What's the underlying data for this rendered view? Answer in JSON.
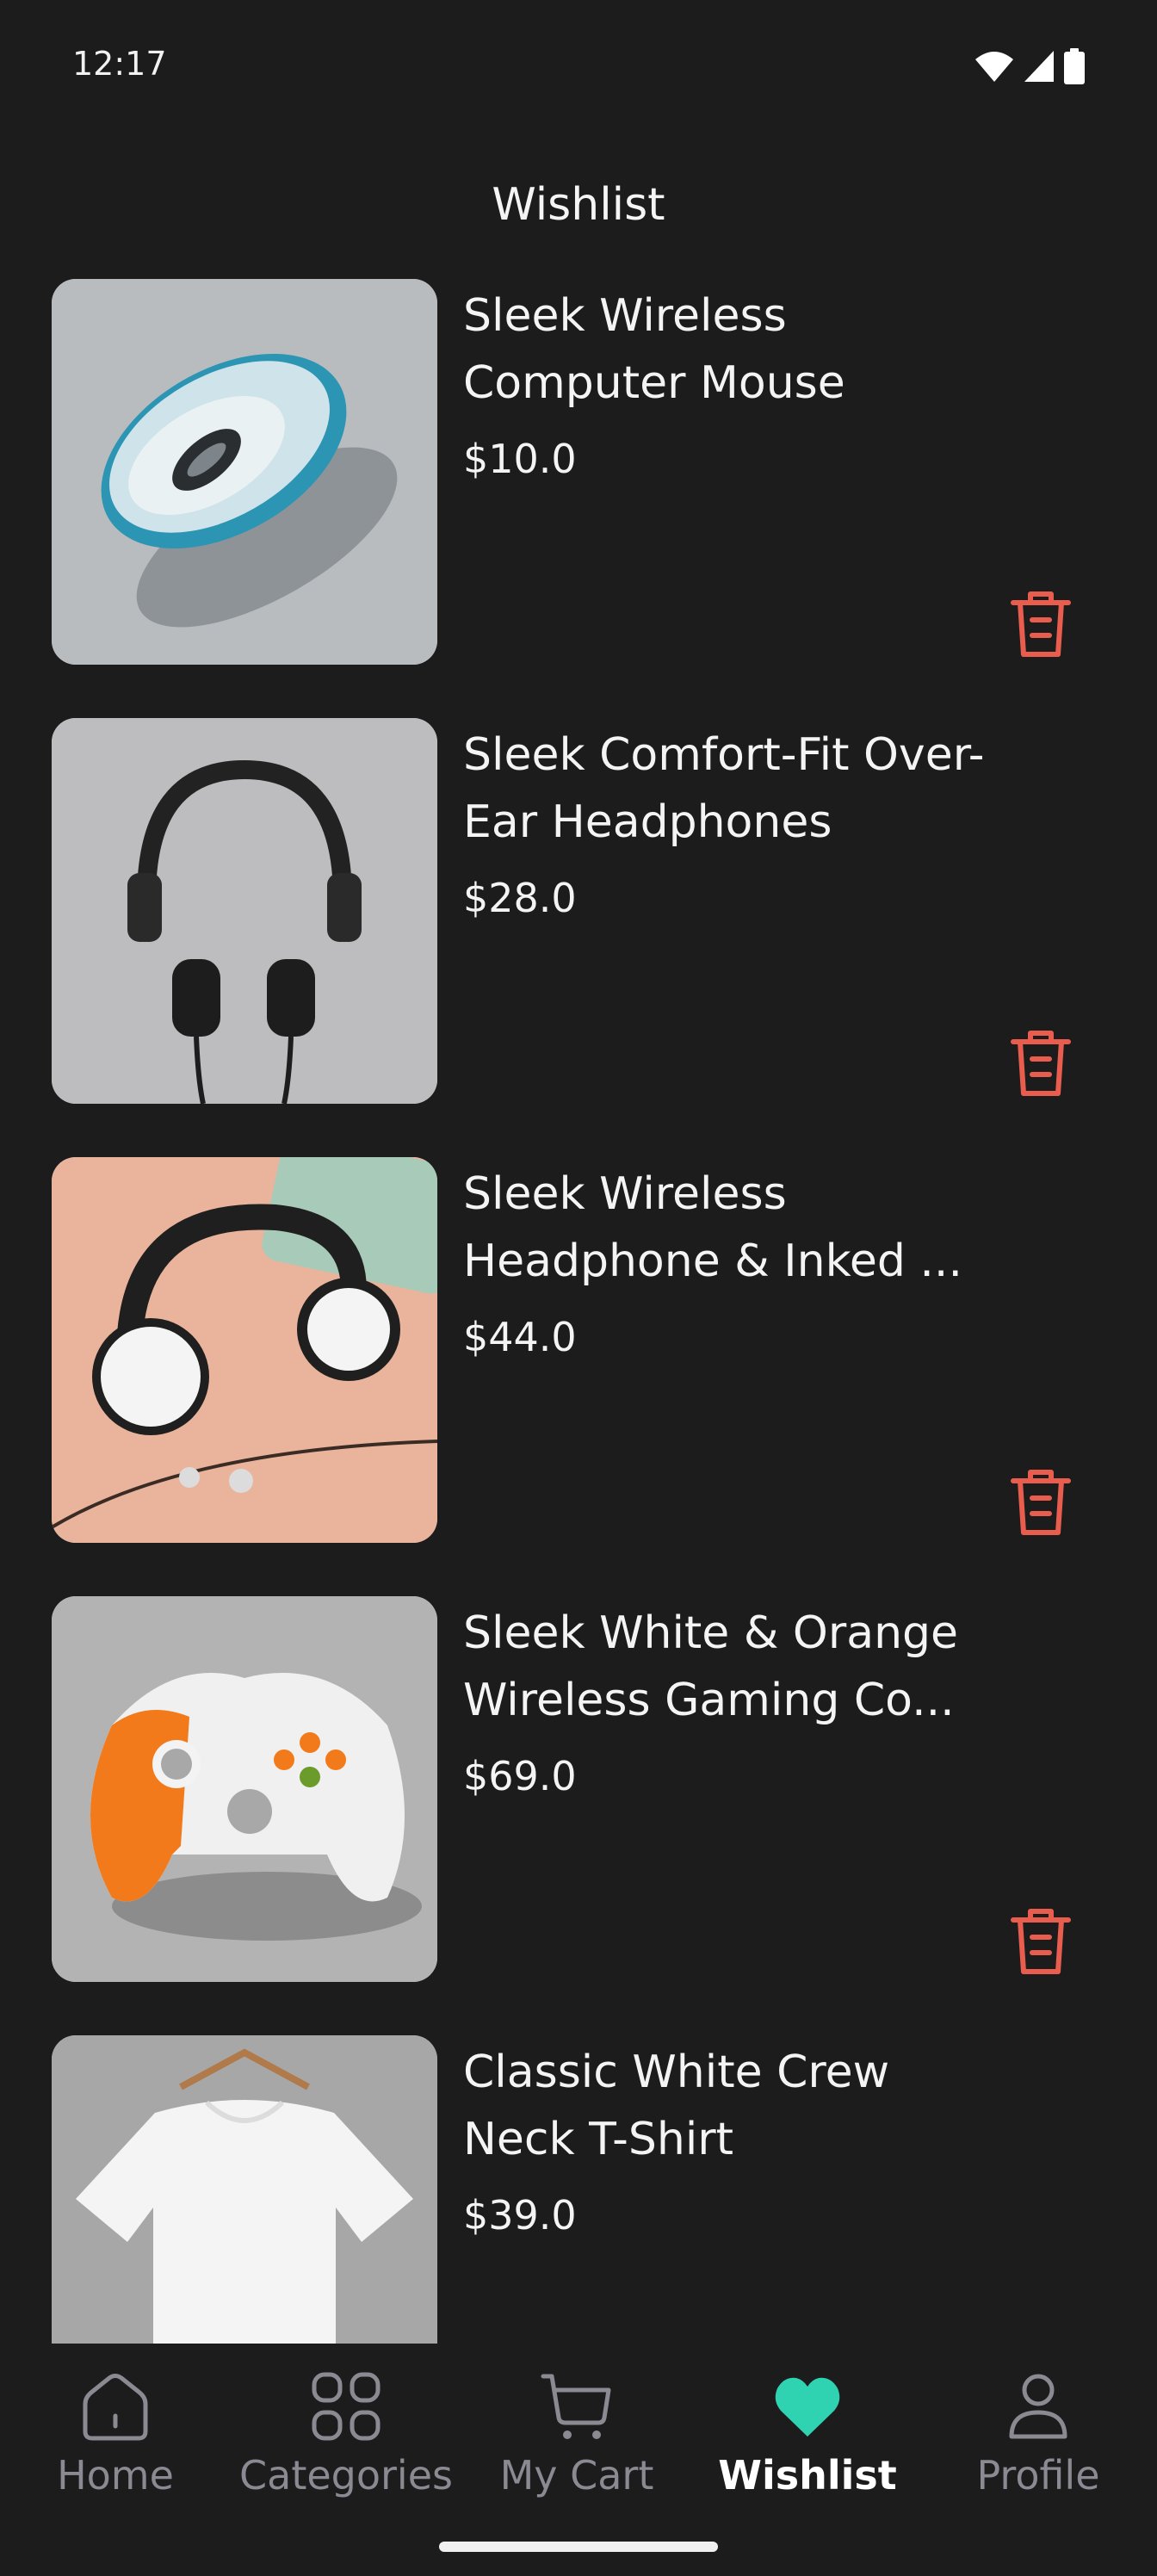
{
  "status_bar": {
    "time": "12:17"
  },
  "header": {
    "title": "Wishlist"
  },
  "colors": {
    "background": "#1c1c1d",
    "delete": "#e85d4e",
    "wishlist_active": "#2fd3b2",
    "nav_inactive": "#8b8a92"
  },
  "wishlist": {
    "items": [
      {
        "name": "Sleek Wireless Computer Mouse",
        "price": "$10.0",
        "image": "wireless-mouse"
      },
      {
        "name": "Sleek Comfort-Fit Over-Ear Headphones",
        "price": "$28.0",
        "image": "over-ear-headphones"
      },
      {
        "name": "Sleek Wireless Headphone & Inked ...",
        "price": "$44.0",
        "image": "white-headphones-earbuds"
      },
      {
        "name": "Sleek White & Orange Wireless Gaming Co...",
        "price": "$69.0",
        "image": "gaming-controller"
      },
      {
        "name": "Classic White Crew Neck T-Shirt",
        "price": "$39.0",
        "image": "white-tshirt"
      }
    ]
  },
  "nav": {
    "items": [
      {
        "label": "Home",
        "icon": "home-icon"
      },
      {
        "label": "Categories",
        "icon": "grid-icon"
      },
      {
        "label": "My Cart",
        "icon": "cart-icon"
      },
      {
        "label": "Wishlist",
        "icon": "heart-icon",
        "active": true
      },
      {
        "label": "Profile",
        "icon": "person-icon"
      }
    ]
  }
}
